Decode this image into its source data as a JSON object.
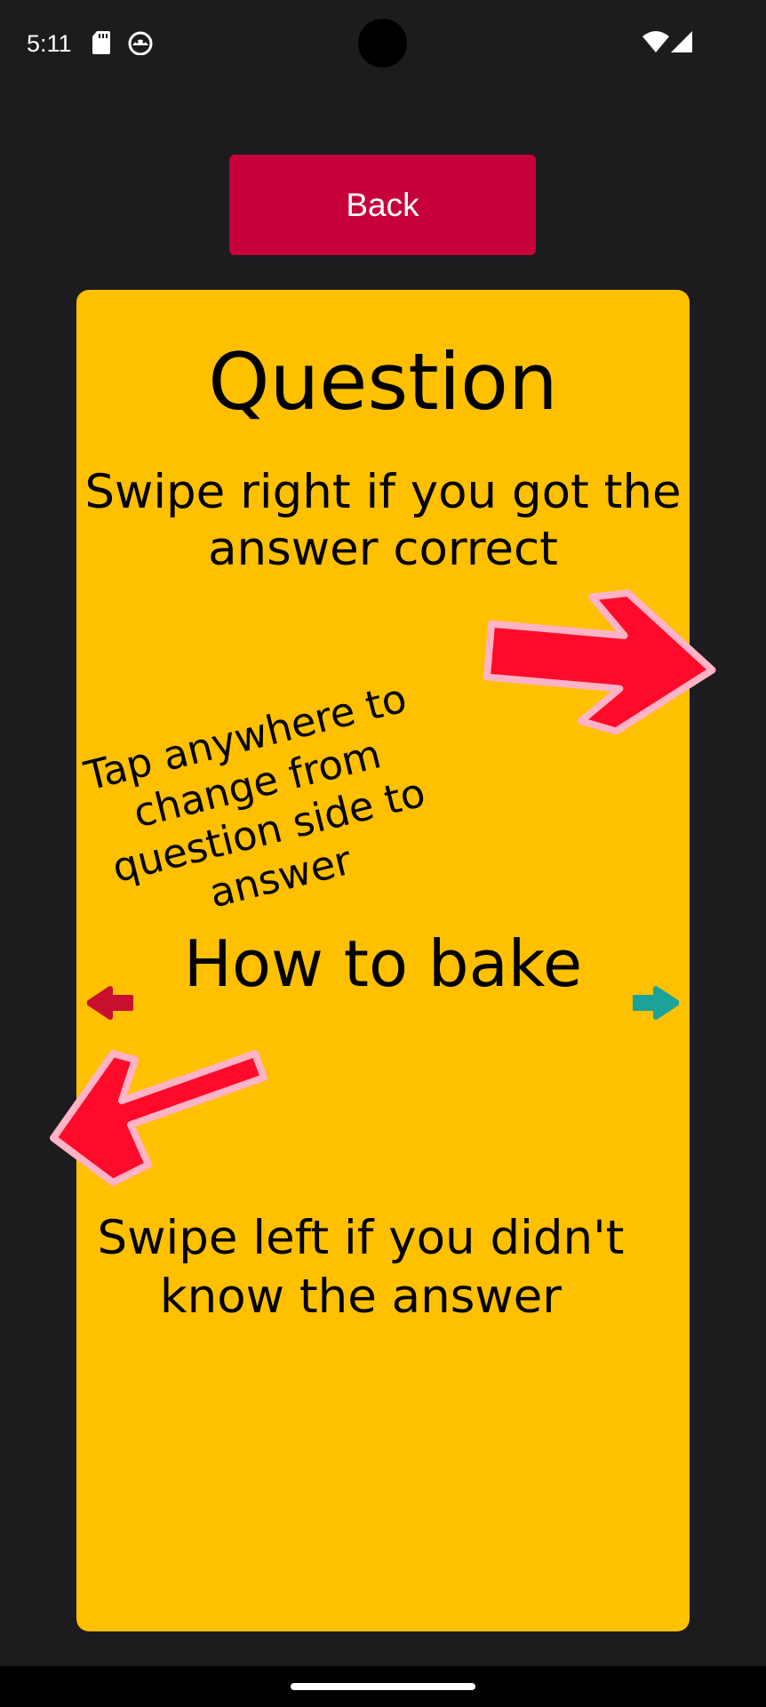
{
  "status_bar": {
    "time": "5:11",
    "icons": [
      "sd-card-icon",
      "android-debug-icon",
      "wifi-icon",
      "cell-signal-icon"
    ]
  },
  "back_button": {
    "label": "Back",
    "color": "#c8003a"
  },
  "card": {
    "background": "#ffc000",
    "title": "Question",
    "swipe_right_hint": "Swipe right if you got the answer correct",
    "tap_hint": "Tap anywhere to change from question side to answer",
    "content": "How to bake",
    "swipe_left_hint": "Swipe left if you didn't know the answer"
  },
  "colors": {
    "background": "#1c1b1e",
    "wrong_indicator": "#c8102e",
    "correct_indicator": "#1aa39a",
    "arrow_fill": "#ff0a2a",
    "arrow_outline": "#ffb3c6"
  },
  "icons": {
    "swipe_right_arrow": "arrow-right-icon",
    "swipe_left_arrow": "arrow-down-left-icon",
    "wrong_indicator": "arrow-left-small-icon",
    "correct_indicator": "arrow-right-small-icon"
  }
}
